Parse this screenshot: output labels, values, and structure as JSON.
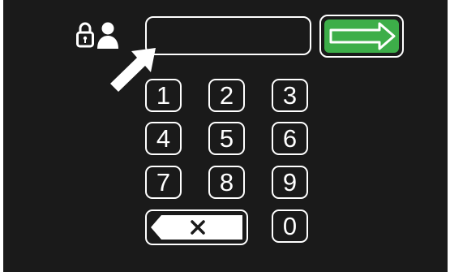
{
  "header": {
    "login_icon": "lock-user-icon",
    "pin_value": "",
    "enter_icon": "arrow-right-icon"
  },
  "keypad": {
    "keys": [
      "1",
      "2",
      "3",
      "4",
      "5",
      "6",
      "7",
      "8",
      "9",
      "0"
    ],
    "backspace_icon": "backspace-x-icon"
  },
  "annotation": {
    "pointer_icon": "pointer-arrow-icon"
  },
  "colors": {
    "screen_bg": "#1a1a1a",
    "enter_green": "#3dae49",
    "foreground": "#ffffff"
  }
}
